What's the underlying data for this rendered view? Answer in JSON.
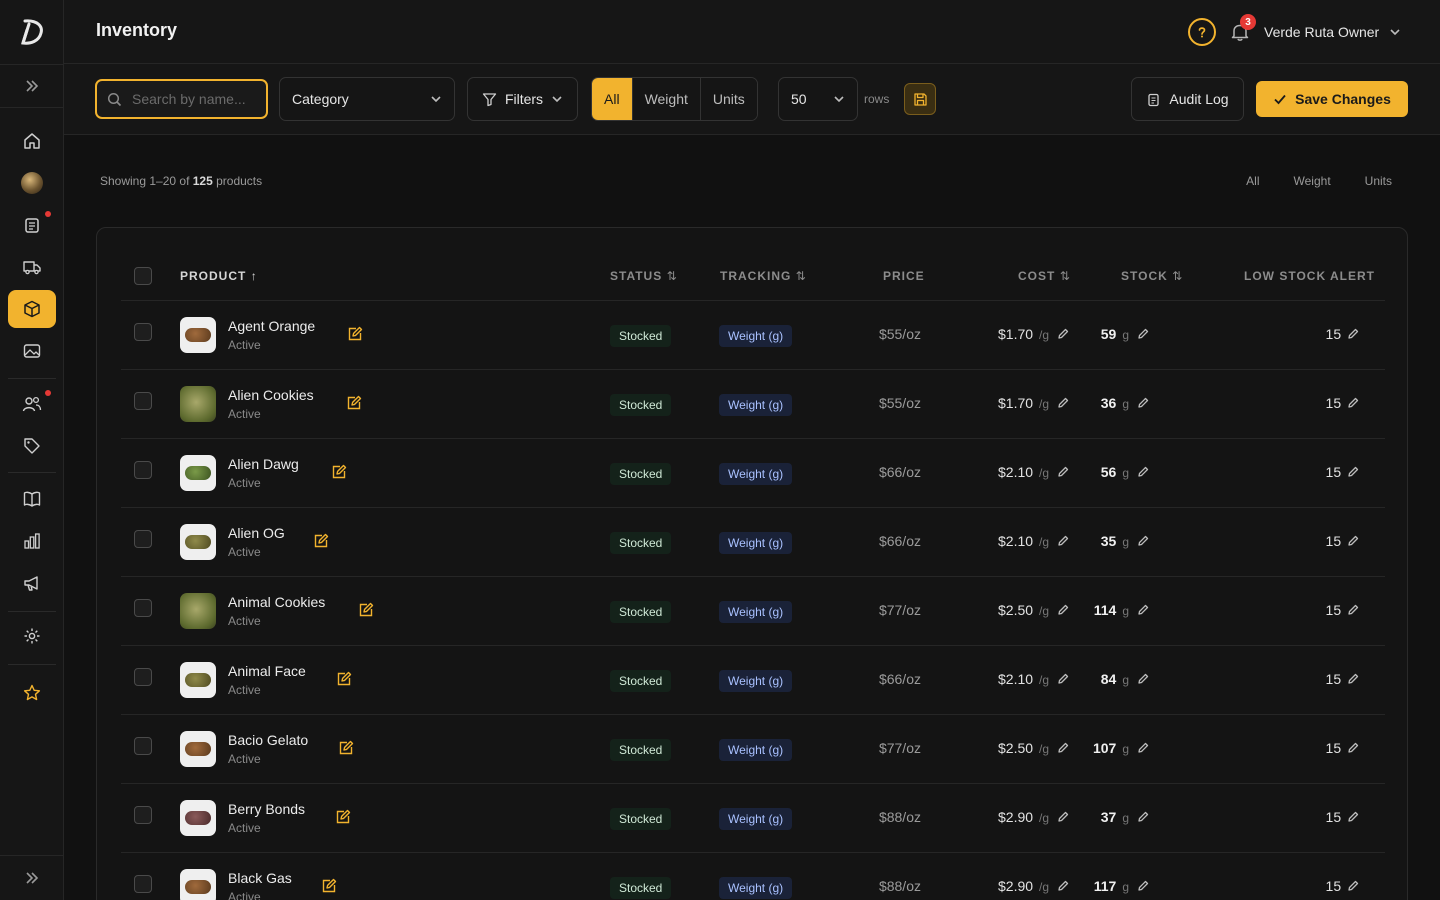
{
  "header": {
    "title": "Inventory",
    "notification_count": "3",
    "user_name": "Verde Ruta Owner"
  },
  "colors": {
    "accent": "#f2b32e",
    "background": "#111111",
    "panel": "#161616",
    "danger": "#e53935"
  },
  "sidebar": {
    "items": [
      {
        "icon": "home-icon"
      },
      {
        "icon": "product-photo-icon"
      },
      {
        "icon": "clipboard-icon",
        "has_dot": true
      },
      {
        "icon": "truck-icon"
      },
      {
        "icon": "box-icon",
        "active": true
      },
      {
        "icon": "image-icon"
      },
      {
        "icon": "users-icon",
        "has_dot": true
      },
      {
        "icon": "tag-icon"
      },
      {
        "icon": "book-icon"
      },
      {
        "icon": "bar-chart-icon"
      },
      {
        "icon": "megaphone-icon"
      },
      {
        "icon": "gear-icon"
      },
      {
        "icon": "star-icon"
      }
    ]
  },
  "toolbar": {
    "search_placeholder": "Search by name...",
    "category_label": "Category",
    "filters_label": "Filters",
    "segments": [
      "All",
      "Weight",
      "Units"
    ],
    "active_segment": "All",
    "rows_value": "50",
    "rows_label": "rows",
    "audit_label": "Audit Log",
    "save_label": "Save Changes"
  },
  "summary": {
    "prefix": "Showing 1–20 of ",
    "total": "125",
    "suffix": " products",
    "view_tabs": [
      "All",
      "Weight",
      "Units"
    ]
  },
  "table": {
    "columns": {
      "product": "PRODUCT",
      "status": "STATUS",
      "tracking": "TRACKING",
      "price": "PRICE",
      "cost": "COST",
      "stock": "STOCK",
      "low_stock": "LOW STOCK ALERT"
    },
    "rows": [
      {
        "name": "Agent Orange",
        "state": "Active",
        "status": "Stocked",
        "tracking": "Weight (g)",
        "price": "$55/oz",
        "cost": "$1.70",
        "cost_unit": "/g",
        "stock": "59",
        "stock_unit": "g",
        "low_alert": "15",
        "thumb": "brown"
      },
      {
        "name": "Alien Cookies",
        "state": "Active",
        "status": "Stocked",
        "tracking": "Weight (g)",
        "price": "$55/oz",
        "cost": "$1.70",
        "cost_unit": "/g",
        "stock": "36",
        "stock_unit": "g",
        "low_alert": "15",
        "thumb": "green-full"
      },
      {
        "name": "Alien Dawg",
        "state": "Active",
        "status": "Stocked",
        "tracking": "Weight (g)",
        "price": "$66/oz",
        "cost": "$2.10",
        "cost_unit": "/g",
        "stock": "56",
        "stock_unit": "g",
        "low_alert": "15",
        "thumb": "green"
      },
      {
        "name": "Alien OG",
        "state": "Active",
        "status": "Stocked",
        "tracking": "Weight (g)",
        "price": "$66/oz",
        "cost": "$2.10",
        "cost_unit": "/g",
        "stock": "35",
        "stock_unit": "g",
        "low_alert": "15",
        "thumb": "olive"
      },
      {
        "name": "Animal Cookies",
        "state": "Active",
        "status": "Stocked",
        "tracking": "Weight (g)",
        "price": "$77/oz",
        "cost": "$2.50",
        "cost_unit": "/g",
        "stock": "114",
        "stock_unit": "g",
        "low_alert": "15",
        "thumb": "green-full"
      },
      {
        "name": "Animal Face",
        "state": "Active",
        "status": "Stocked",
        "tracking": "Weight (g)",
        "price": "$66/oz",
        "cost": "$2.10",
        "cost_unit": "/g",
        "stock": "84",
        "stock_unit": "g",
        "low_alert": "15",
        "thumb": "olive"
      },
      {
        "name": "Bacio Gelato",
        "state": "Active",
        "status": "Stocked",
        "tracking": "Weight (g)",
        "price": "$77/oz",
        "cost": "$2.50",
        "cost_unit": "/g",
        "stock": "107",
        "stock_unit": "g",
        "low_alert": "15",
        "thumb": "brown"
      },
      {
        "name": "Berry Bonds",
        "state": "Active",
        "status": "Stocked",
        "tracking": "Weight (g)",
        "price": "$88/oz",
        "cost": "$2.90",
        "cost_unit": "/g",
        "stock": "37",
        "stock_unit": "g",
        "low_alert": "15",
        "thumb": "purple"
      },
      {
        "name": "Black Gas",
        "state": "Active",
        "status": "Stocked",
        "tracking": "Weight (g)",
        "price": "$88/oz",
        "cost": "$2.90",
        "cost_unit": "/g",
        "stock": "117",
        "stock_unit": "g",
        "low_alert": "15",
        "thumb": "brown"
      }
    ]
  }
}
